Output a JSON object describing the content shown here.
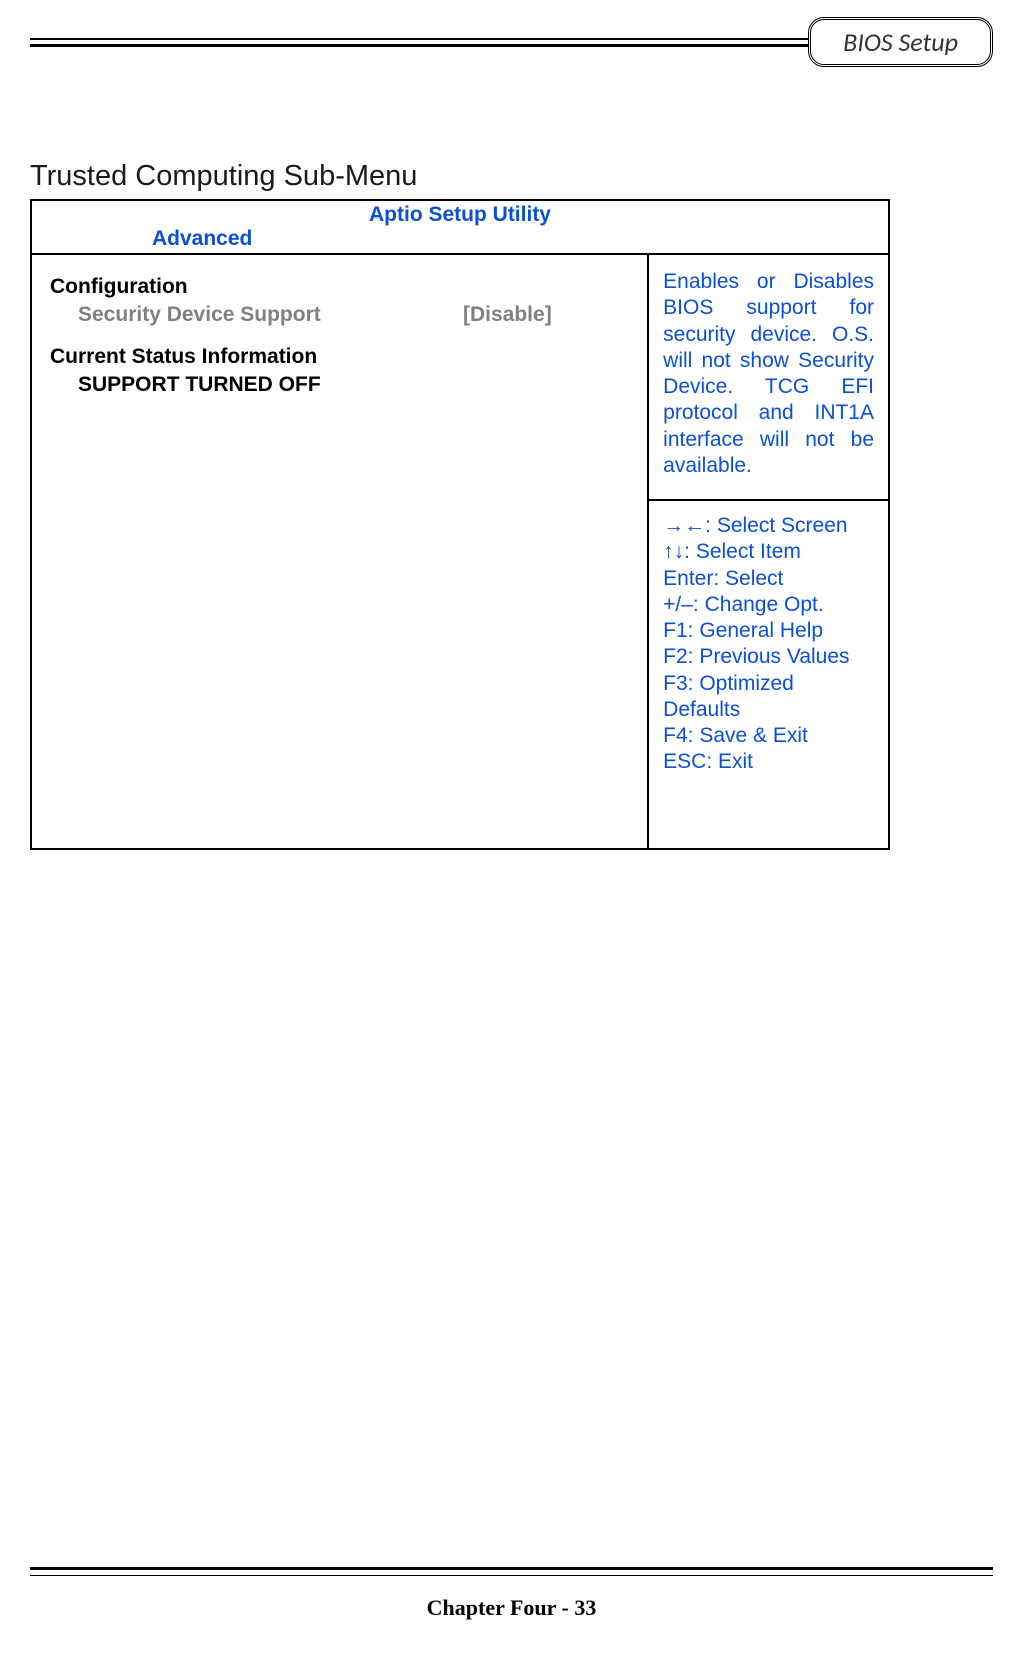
{
  "header": {
    "badge": "BIOS Setup"
  },
  "section": {
    "title": "Trusted Computing Sub-Menu"
  },
  "bios": {
    "utility_title": "Aptio Setup Utility",
    "tab": "Advanced",
    "configuration_heading": "Configuration",
    "item_label": "Security Device Support",
    "item_value": "[Disable]",
    "status_heading": "Current Status Information",
    "status_value": "SUPPORT TURNED OFF",
    "help_text": "Enables or Disables BIOS support for security device. O.S. will not show Security Device. TCG EFI protocol and INT1A interface will not be available.",
    "keys": [
      "→←: Select Screen",
      "↑↓: Select Item",
      "Enter: Select",
      "+/–: Change Opt.",
      "F1: General Help",
      "F2: Previous Values",
      "F3: Optimized Defaults",
      "F4: Save & Exit",
      "ESC: Exit"
    ]
  },
  "footer": {
    "text": "Chapter Four - 33"
  }
}
